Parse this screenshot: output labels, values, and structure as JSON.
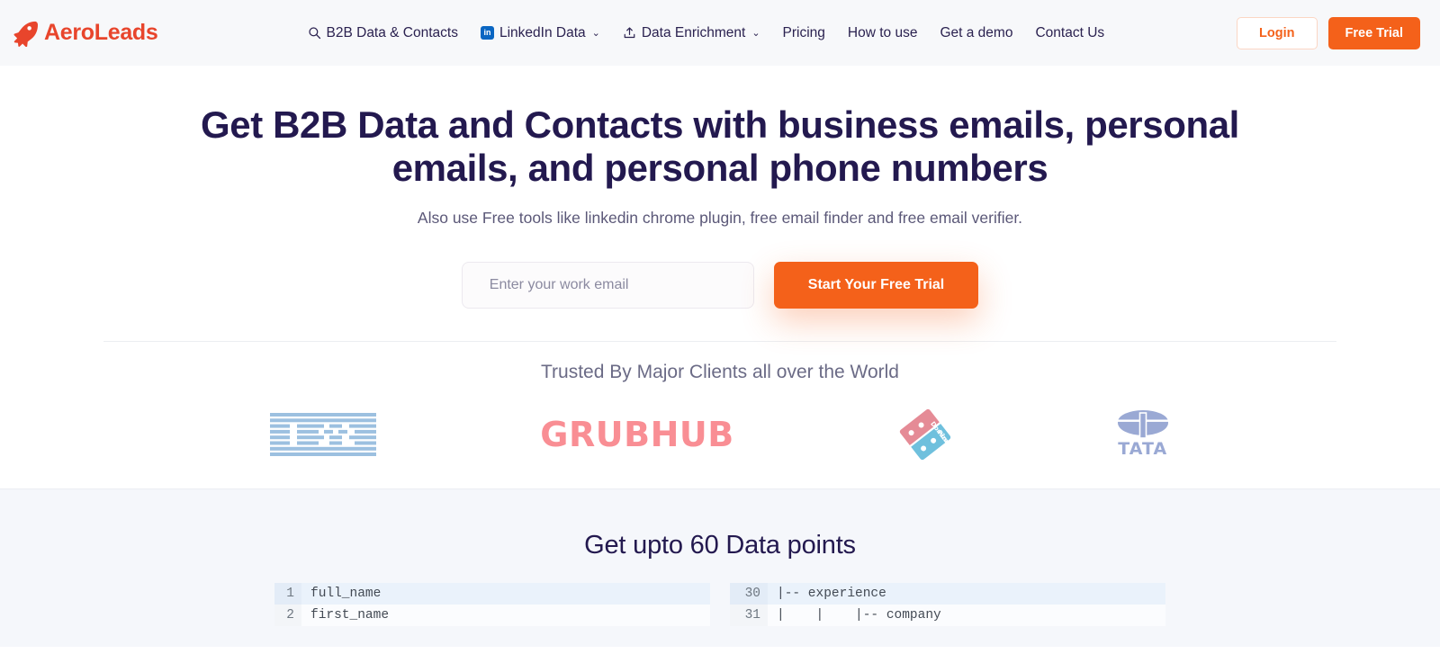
{
  "brand": {
    "name": "AeroLeads",
    "icon": "rocket-icon",
    "color": "#e8452c"
  },
  "nav": {
    "items": [
      {
        "label": "B2B Data & Contacts",
        "icon": "search-icon",
        "caret": ""
      },
      {
        "label": "LinkedIn Data",
        "icon": "linkedin-icon",
        "caret": "⌄"
      },
      {
        "label": "Data Enrichment",
        "icon": "upload-icon",
        "caret": "⌄"
      },
      {
        "label": "Pricing",
        "icon": "",
        "caret": ""
      },
      {
        "label": "How to use",
        "icon": "",
        "caret": ""
      },
      {
        "label": "Get a demo",
        "icon": "",
        "caret": ""
      },
      {
        "label": "Contact Us",
        "icon": "",
        "caret": ""
      }
    ],
    "login_label": "Login",
    "free_trial_label": "Free Trial",
    "accent_color": "#f4611a"
  },
  "hero": {
    "title": "Get B2B Data and Contacts with business emails, personal emails, and personal phone numbers",
    "subtitle": "Also use Free tools like linkedin chrome plugin, free email finder and free email verifier.",
    "email_placeholder": "Enter your work email",
    "email_value": "",
    "cta_label": "Start Your Free Trial"
  },
  "trusted": {
    "title": "Trusted By Major Clients all over the World",
    "logos": [
      {
        "name": "IBM",
        "color": "#9cc0e0"
      },
      {
        "name": "GRUBHUB",
        "color": "#f98e94"
      },
      {
        "name": "Domino's Pizza",
        "color": "#e58b96"
      },
      {
        "name": "TATA",
        "color": "#9aa9d4"
      }
    ]
  },
  "datapoints": {
    "title": "Get upto 60 Data points",
    "left_code": [
      {
        "num": "1",
        "text": "full_name",
        "highlight": true
      },
      {
        "num": "2",
        "text": "first_name",
        "highlight": false
      }
    ],
    "right_code": [
      {
        "num": "30",
        "text": "|-- experience",
        "highlight": true
      },
      {
        "num": "31",
        "text": "|    |    |-- company",
        "highlight": false
      }
    ]
  }
}
